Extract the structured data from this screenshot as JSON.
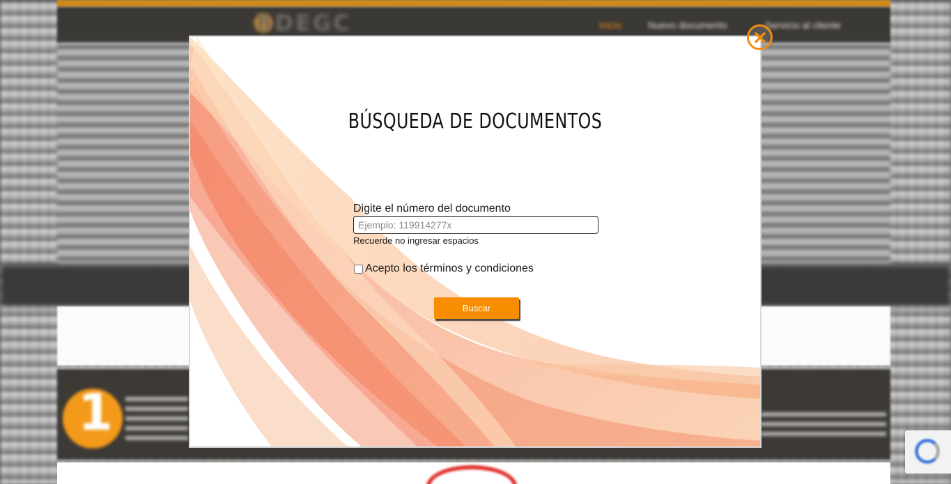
{
  "background": {
    "logo_text": "BDEGC",
    "nav": [
      "Inicio",
      "Nuevo documento",
      "Servicio al cliente"
    ],
    "step_number": "1"
  },
  "modal": {
    "title": "BÚSQUEDA DE DOCUMENTOS",
    "field_label": "Digite el número del documento",
    "input_value": "",
    "input_placeholder": "Ejemplo: 119914277x",
    "hint": "Recuerde no ingresar espacios",
    "terms_label": "Acepto los términos y condiciones",
    "terms_checked": false,
    "search_label": "Buscar"
  },
  "icons": {
    "close": "close-circle-icon",
    "background_brand": "logo-mark-icon",
    "captcha": "recaptcha-icon"
  },
  "colors": {
    "accent": "#f98d00",
    "close_ring": "#f08c12",
    "header_dark": "#3b3935",
    "swoosh": "#f4826a"
  }
}
